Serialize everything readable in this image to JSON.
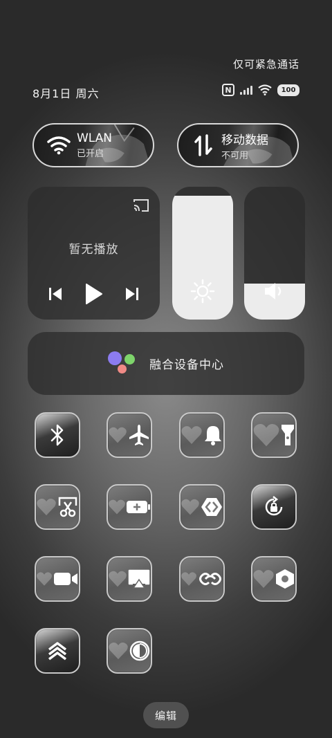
{
  "status": {
    "emergency": "仅可紧急通话",
    "date": "8月1日 周六",
    "nfc_label": "N",
    "battery": "100"
  },
  "wlan": {
    "title": "WLAN",
    "subtitle": "已开启"
  },
  "mobile_data": {
    "title": "移动数据",
    "subtitle": "不可用"
  },
  "media": {
    "status": "暂无播放"
  },
  "brightness": {
    "level": 0.93
  },
  "volume": {
    "level": 0.27
  },
  "device_center": {
    "label": "融合设备中心"
  },
  "toggles": [
    {
      "icon": "bluetooth-icon",
      "style": "dark"
    },
    {
      "icon": "airplane-icon",
      "style": "light"
    },
    {
      "icon": "bell-icon",
      "style": "light"
    },
    {
      "icon": "flashlight-icon",
      "style": "light"
    },
    {
      "icon": "screenshot-icon",
      "style": "light"
    },
    {
      "icon": "battery-saver-icon",
      "style": "light"
    },
    {
      "icon": "hotspot-icon",
      "style": "light"
    },
    {
      "icon": "rotation-lock-icon",
      "style": "dark"
    },
    {
      "icon": "screen-record-icon",
      "style": "light"
    },
    {
      "icon": "screen-cast-icon",
      "style": "light"
    },
    {
      "icon": "link-icon",
      "style": "light"
    },
    {
      "icon": "nfc-settings-icon",
      "style": "light"
    },
    {
      "icon": "share-icon",
      "style": "dark"
    },
    {
      "icon": "dark-mode-icon",
      "style": "light"
    }
  ],
  "edit_label": "编辑",
  "colors": {
    "dot_purple": "#8c7cf0",
    "dot_green": "#7ed46b",
    "dot_pink": "#f08a86",
    "slider_fill": "#ececec"
  }
}
